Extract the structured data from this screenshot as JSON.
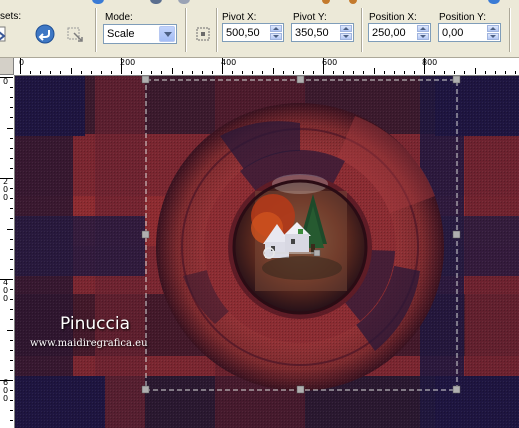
{
  "toolbar": {
    "presets_label": "sets:",
    "mode": {
      "label": "Mode:",
      "value": "Scale"
    },
    "pivot_x": {
      "label": "Pivot X:",
      "value": "500,50"
    },
    "pivot_y": {
      "label": "Pivot Y:",
      "value": "350,50"
    },
    "position_x": {
      "label": "Position X:",
      "value": "250,00"
    },
    "position_y": {
      "label": "Position Y:",
      "value": "0,00"
    }
  },
  "ruler": {
    "horizontal_labels": [
      "0",
      "200",
      "400",
      "600",
      "800"
    ],
    "vertical_labels": [
      "0",
      "2",
      "0",
      "0",
      "4",
      "0",
      "0",
      "6",
      "0",
      "0"
    ]
  },
  "watermark": {
    "name": "Pinuccia",
    "url": "www.maidiregrafica.eu"
  },
  "colors": {
    "toolbar_bg": "#ece9d8",
    "canvas_dark": "#1e1535",
    "canvas_red": "#8e2a2e",
    "selection": "#e0e0e0"
  }
}
